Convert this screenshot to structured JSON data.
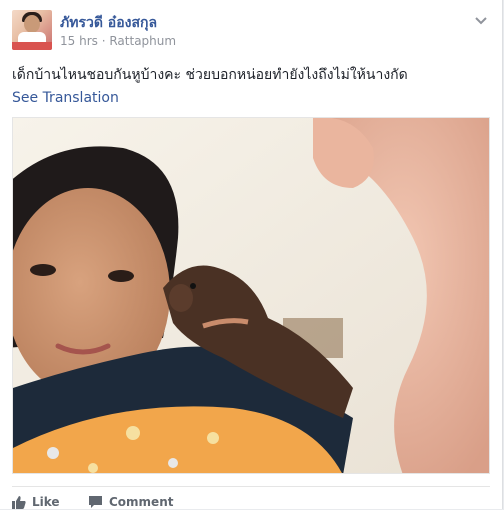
{
  "post": {
    "author_name": "ภัทรวดี อ๋องสกุล",
    "time": "15 hrs",
    "separator": "·",
    "location": "Rattaphum",
    "text": "เด็กบ้านไหนชอบกันหูบ้างคะ ช่วยบอกหน่อยทำยังไงถึงไม่ให้นางกัด",
    "see_translation": "See Translation"
  },
  "actions": {
    "like_label": "Like",
    "comment_label": "Comment"
  },
  "icons": {
    "avatar": "profile-photo",
    "chevron": "chevron-down-icon",
    "like": "thumbs-up-icon",
    "comment": "speech-bubble-icon"
  },
  "colors": {
    "link_blue": "#365899",
    "meta_gray": "#90949c",
    "action_gray": "#606770",
    "text": "#1d2129"
  }
}
